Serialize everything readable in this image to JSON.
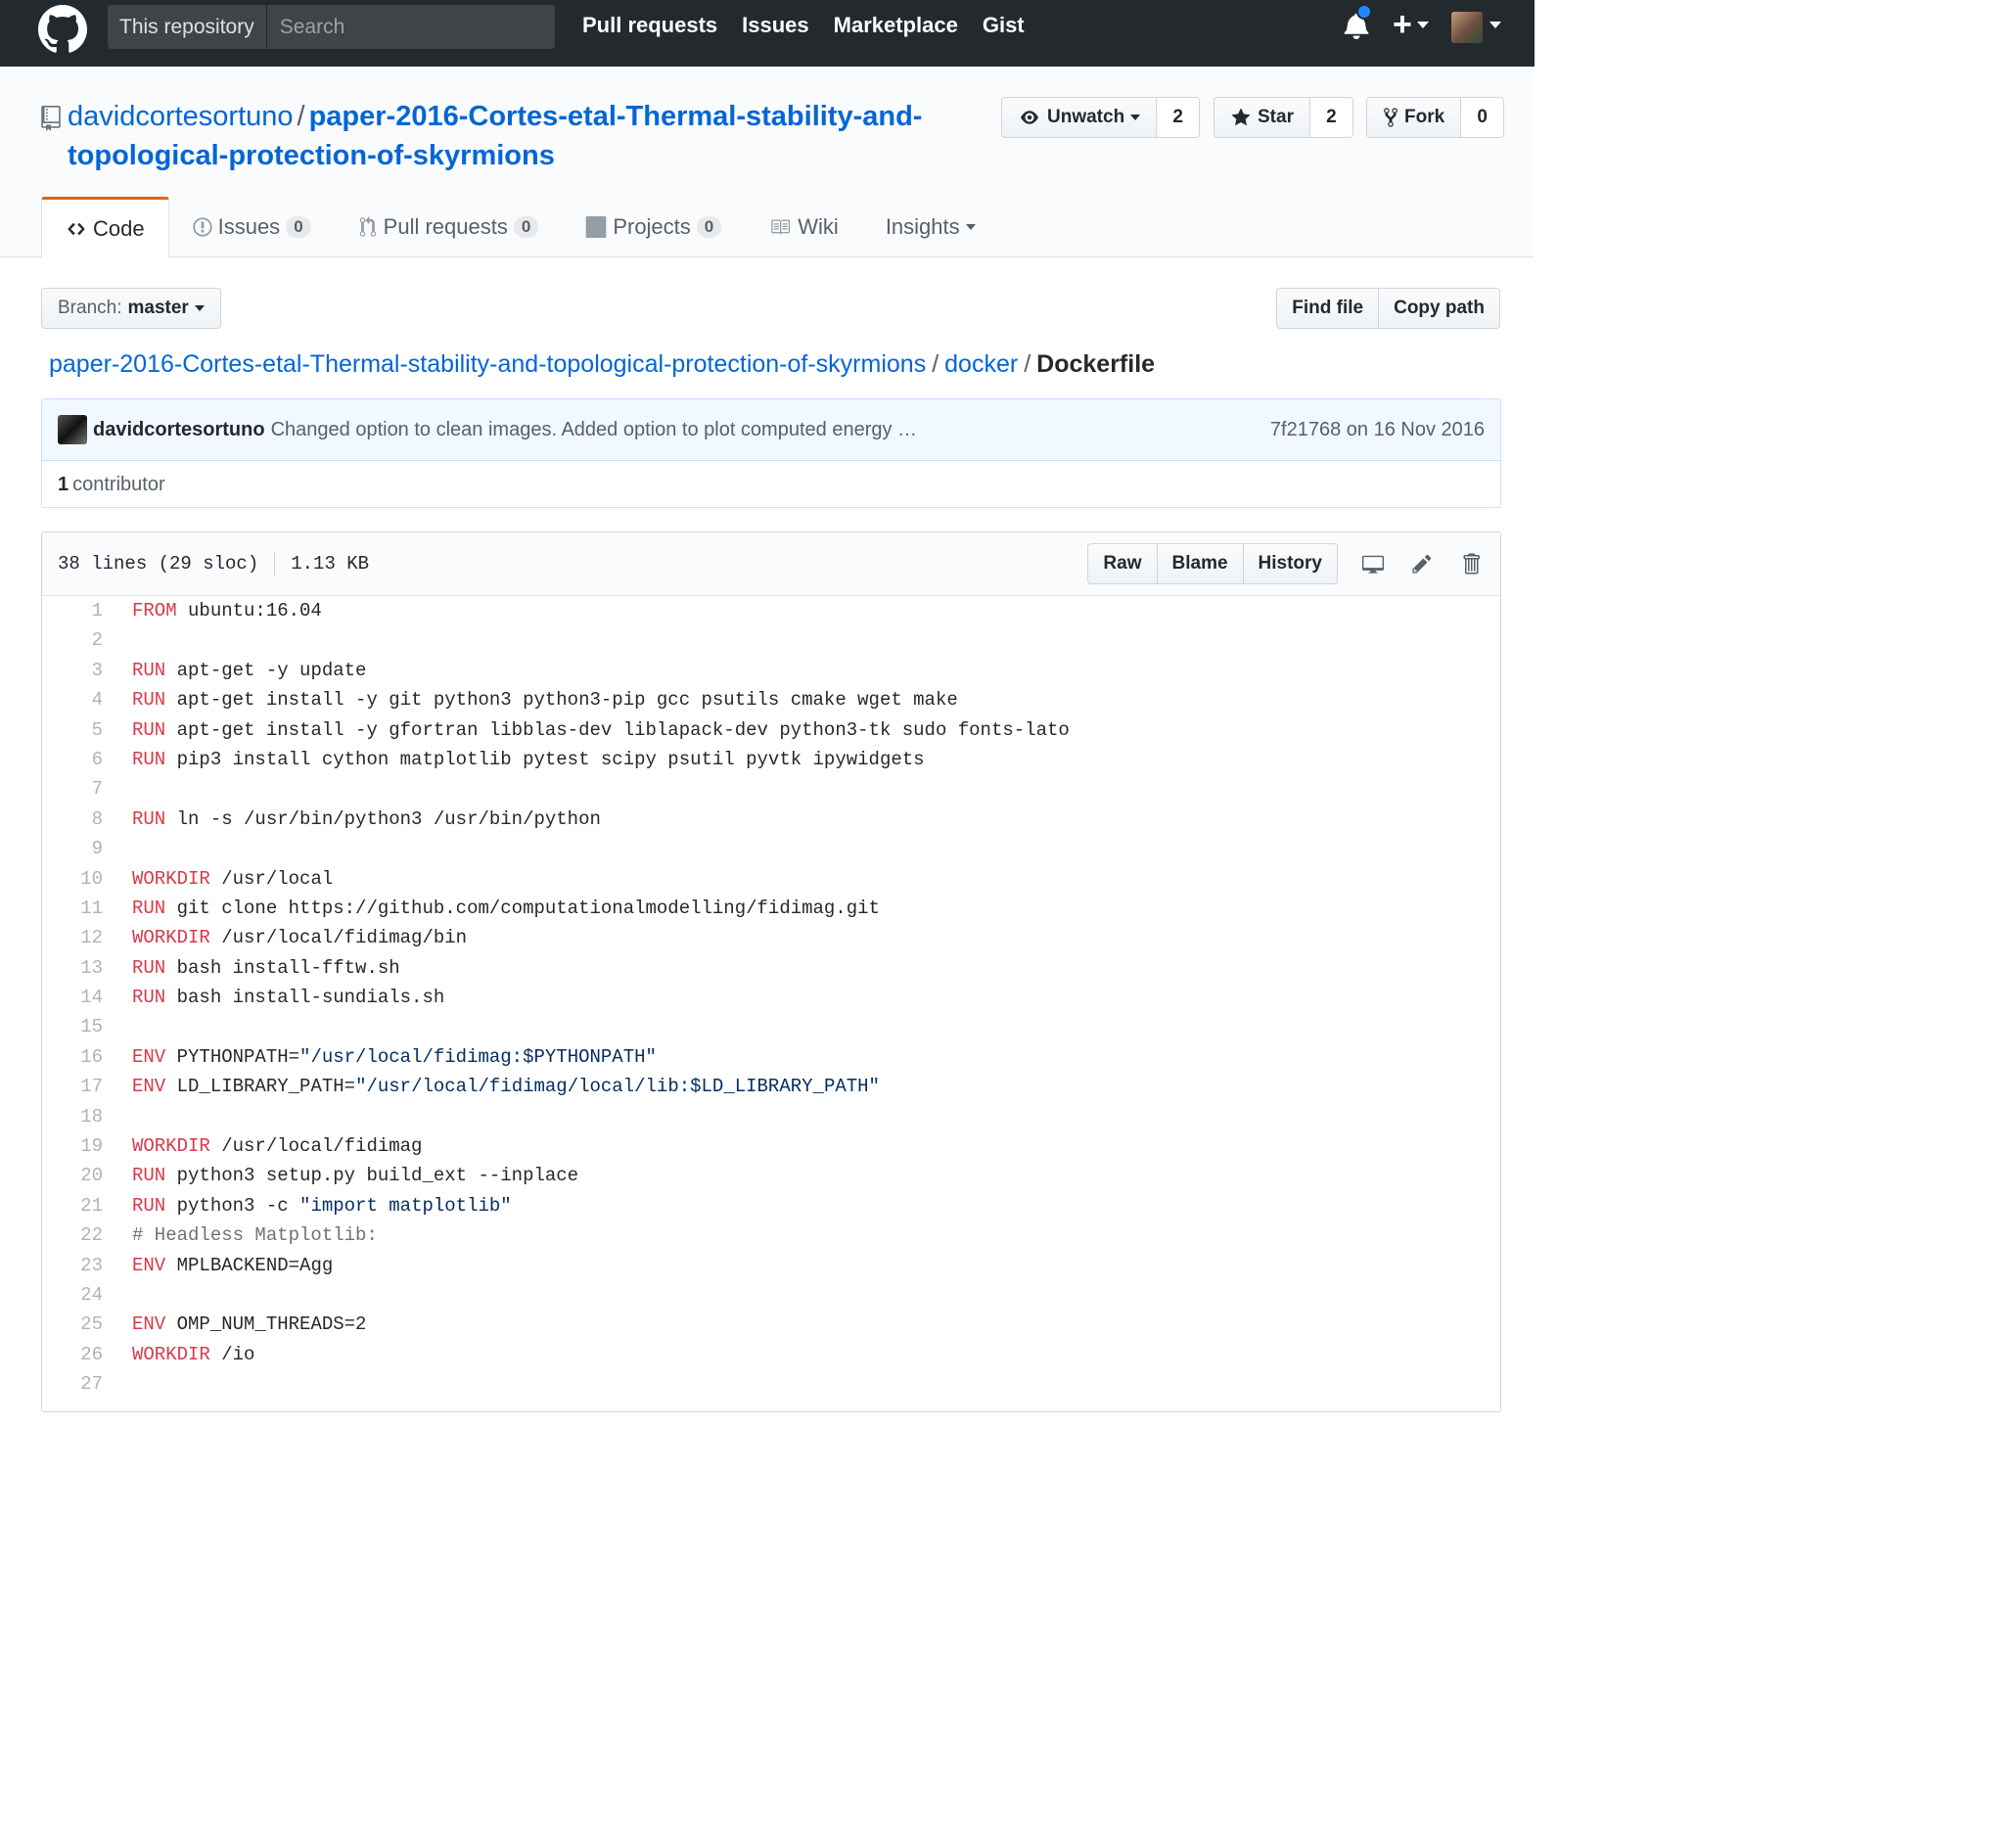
{
  "header": {
    "search_scope": "This repository",
    "search_placeholder": "Search",
    "nav": [
      "Pull requests",
      "Issues",
      "Marketplace",
      "Gist"
    ],
    "icons": [
      "github-logo-icon",
      "bell-icon",
      "plus-icon",
      "avatar"
    ]
  },
  "repo": {
    "owner": "davidcortesortuno",
    "separator": "/",
    "name": "paper-2016-Cortes-etal-Thermal-stability-and-topological-protection-of-skyrmions",
    "watch_label": "Unwatch",
    "watch_count": "2",
    "star_label": "Star",
    "star_count": "2",
    "fork_label": "Fork",
    "fork_count": "0"
  },
  "tabs": [
    {
      "label": "Code",
      "count": null,
      "selected": true
    },
    {
      "label": "Issues",
      "count": "0"
    },
    {
      "label": "Pull requests",
      "count": "0"
    },
    {
      "label": "Projects",
      "count": "0"
    },
    {
      "label": "Wiki",
      "count": null
    },
    {
      "label": "Insights",
      "count": null
    }
  ],
  "file_nav": {
    "branch_label": "Branch:",
    "branch_value": "master",
    "find_file": "Find file",
    "copy_path": "Copy path"
  },
  "breadcrumb": {
    "root": "paper-2016-Cortes-etal-Thermal-stability-and-topological-protection-of-skyrmions",
    "sep": "/",
    "dir": "docker",
    "file": "Dockerfile"
  },
  "commit": {
    "author": "davidcortesortuno",
    "message": "Changed option to clean images. Added option to plot computed energy …",
    "sha_date": "7f21768 on 16 Nov 2016",
    "contributors_count": "1",
    "contributors_label": "contributor"
  },
  "file": {
    "lines_info": "38 lines (29 sloc)",
    "size": "1.13 KB",
    "raw": "Raw",
    "blame": "Blame",
    "history": "History"
  },
  "code": [
    {
      "n": "1",
      "kw": "FROM",
      "rest": " ubuntu:16.04"
    },
    {
      "n": "2",
      "kw": "",
      "rest": ""
    },
    {
      "n": "3",
      "kw": "RUN",
      "rest": " apt-get -y update"
    },
    {
      "n": "4",
      "kw": "RUN",
      "rest": " apt-get install -y git python3 python3-pip gcc psutils cmake wget make"
    },
    {
      "n": "5",
      "kw": "RUN",
      "rest": " apt-get install -y gfortran libblas-dev liblapack-dev python3-tk sudo fonts-lato"
    },
    {
      "n": "6",
      "kw": "RUN",
      "rest": " pip3 install cython matplotlib pytest scipy psutil pyvtk ipywidgets"
    },
    {
      "n": "7",
      "kw": "",
      "rest": ""
    },
    {
      "n": "8",
      "kw": "RUN",
      "rest": " ln -s /usr/bin/python3 /usr/bin/python"
    },
    {
      "n": "9",
      "kw": "",
      "rest": ""
    },
    {
      "n": "10",
      "kw": "WORKDIR",
      "rest": " /usr/local"
    },
    {
      "n": "11",
      "kw": "RUN",
      "rest": " git clone https://github.com/computationalmodelling/fidimag.git"
    },
    {
      "n": "12",
      "kw": "WORKDIR",
      "rest": " /usr/local/fidimag/bin"
    },
    {
      "n": "13",
      "kw": "RUN",
      "rest": " bash install-fftw.sh"
    },
    {
      "n": "14",
      "kw": "RUN",
      "rest": " bash install-sundials.sh"
    },
    {
      "n": "15",
      "kw": "",
      "rest": ""
    },
    {
      "n": "16",
      "kw": "ENV",
      "rest": " PYTHONPATH=",
      "str": "\"/usr/local/fidimag:$PYTHONPATH\""
    },
    {
      "n": "17",
      "kw": "ENV",
      "rest": " LD_LIBRARY_PATH=",
      "str": "\"/usr/local/fidimag/local/lib:$LD_LIBRARY_PATH\""
    },
    {
      "n": "18",
      "kw": "",
      "rest": ""
    },
    {
      "n": "19",
      "kw": "WORKDIR",
      "rest": " /usr/local/fidimag"
    },
    {
      "n": "20",
      "kw": "RUN",
      "rest": " python3 setup.py build_ext --inplace"
    },
    {
      "n": "21",
      "kw": "RUN",
      "rest": " python3 -c ",
      "str": "\"import matplotlib\""
    },
    {
      "n": "22",
      "kw": "",
      "rest": "",
      "comment": "# Headless Matplotlib:"
    },
    {
      "n": "23",
      "kw": "ENV",
      "rest": " MPLBACKEND=Agg"
    },
    {
      "n": "24",
      "kw": "",
      "rest": ""
    },
    {
      "n": "25",
      "kw": "ENV",
      "rest": " OMP_NUM_THREADS=2"
    },
    {
      "n": "26",
      "kw": "WORKDIR",
      "rest": " /io"
    },
    {
      "n": "27",
      "kw": "",
      "rest": ""
    }
  ]
}
